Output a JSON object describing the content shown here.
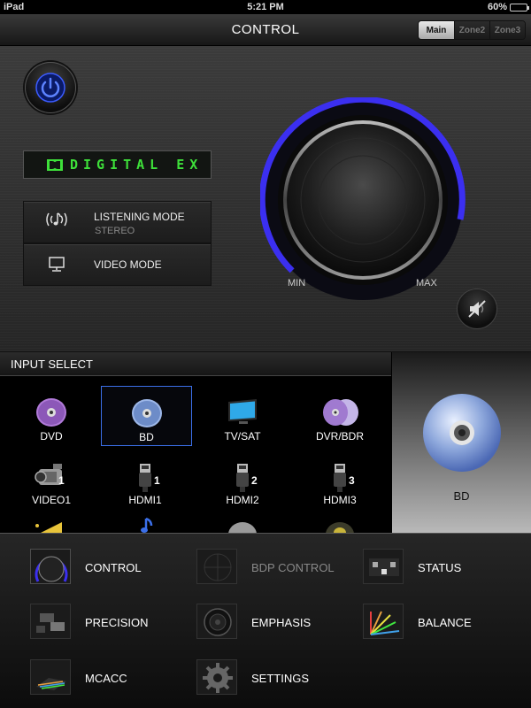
{
  "status_bar": {
    "device": "iPad",
    "time": "5:21 PM",
    "battery": "60%"
  },
  "header": {
    "title": "CONTROL",
    "zones": [
      {
        "label": "Main",
        "active": true
      },
      {
        "label": "Zone2",
        "active": false
      },
      {
        "label": "Zone3",
        "active": false
      }
    ]
  },
  "control": {
    "display_text": "DIGITAL EX",
    "listening_mode_label": "LISTENING MODE",
    "listening_mode_value": "STEREO",
    "video_mode_label": "VIDEO MODE",
    "volume_min_label": "MIN",
    "volume_max_label": "MAX",
    "accent_color": "#3b2ff0"
  },
  "input_select": {
    "title": "INPUT SELECT",
    "selected": "BD",
    "items": [
      {
        "label": "DVD",
        "icon": "disc-icon"
      },
      {
        "label": "BD",
        "icon": "disc-icon"
      },
      {
        "label": "TV/SAT",
        "icon": "tv-icon"
      },
      {
        "label": "DVR/BDR",
        "icon": "double-disc-icon"
      },
      {
        "label": "VIDEO1",
        "icon": "camcorder-icon",
        "number": "1"
      },
      {
        "label": "HDMI1",
        "icon": "hdmi-plug-icon",
        "number": "1"
      },
      {
        "label": "HDMI2",
        "icon": "hdmi-plug-icon",
        "number": "2"
      },
      {
        "label": "HDMI3",
        "icon": "hdmi-plug-icon",
        "number": "3"
      }
    ]
  },
  "preview": {
    "label": "BD",
    "icon": "disc-icon"
  },
  "menu": {
    "items": [
      {
        "label": "CONTROL",
        "icon": "volume-knob-icon",
        "enabled": true
      },
      {
        "label": "BDP CONTROL",
        "icon": "radar-icon",
        "enabled": false
      },
      {
        "label": "STATUS",
        "icon": "stage-icon",
        "enabled": true
      },
      {
        "label": "PRECISION",
        "icon": "equipment-icon",
        "enabled": true
      },
      {
        "label": "EMPHASIS",
        "icon": "speaker-icon",
        "enabled": true
      },
      {
        "label": "BALANCE",
        "icon": "fan-chart-icon",
        "enabled": true
      },
      {
        "label": "MCACC",
        "icon": "room-icon",
        "enabled": true
      },
      {
        "label": "SETTINGS",
        "icon": "gear-icon",
        "enabled": true
      }
    ]
  }
}
